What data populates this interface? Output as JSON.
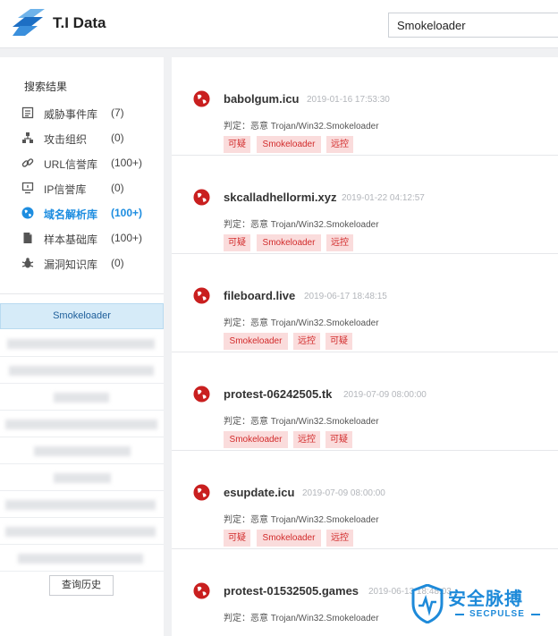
{
  "app": {
    "name": "T.I Data"
  },
  "search": {
    "value": "Smokeloader"
  },
  "sidebar": {
    "title": "搜索结果",
    "categories": [
      {
        "icon": "threat-event-icon",
        "label": "威胁事件库",
        "count": "(7)"
      },
      {
        "icon": "org-tree-icon",
        "label": "攻击组织",
        "count": "(0)"
      },
      {
        "icon": "link-icon",
        "label": "URL信誉库",
        "count": "(100+)"
      },
      {
        "icon": "ip-monitor-icon",
        "label": "IP信誉库",
        "count": "(0)"
      },
      {
        "icon": "globe-icon",
        "label": "域名解析库",
        "count": "(100+)"
      },
      {
        "icon": "document-icon",
        "label": "样本基础库",
        "count": "(100+)"
      },
      {
        "icon": "bug-icon",
        "label": "漏洞知识库",
        "count": "(0)"
      }
    ],
    "active_history": "Smokeloader",
    "history_button": "查询历史"
  },
  "results": [
    {
      "domain": "babolgum.icu",
      "date": "2019-01-16 17:53:30",
      "verdict": "判定：恶意 Trojan/Win32.Smokeloader",
      "tags": [
        "可疑",
        "Smokeloader",
        "远控"
      ]
    },
    {
      "domain": "skcalladhellormi.xyz",
      "date": "2019-01-22 04:12:57",
      "verdict": "判定：恶意 Trojan/Win32.Smokeloader",
      "tags": [
        "可疑",
        "Smokeloader",
        "远控"
      ]
    },
    {
      "domain": "fileboard.live",
      "date": "2019-06-17 18:48:15",
      "verdict": "判定：恶意 Trojan/Win32.Smokeloader",
      "tags": [
        "Smokeloader",
        "远控",
        "可疑"
      ]
    },
    {
      "domain": "protest-06242505.tk",
      "date": "2019-07-09 08:00:00",
      "verdict": "判定：恶意 Trojan/Win32.Smokeloader",
      "tags": [
        "Smokeloader",
        "远控",
        "可疑"
      ]
    },
    {
      "domain": "esupdate.icu",
      "date": "2019-07-09 08:00:00",
      "verdict": "判定：恶意 Trojan/Win32.Smokeloader",
      "tags": [
        "可疑",
        "Smokeloader",
        "远控"
      ]
    },
    {
      "domain": "protest-01532505.games",
      "date": "2019-06-13 18:48:03",
      "verdict": "判定：恶意 Trojan/Win32.Smokeloader",
      "tags": []
    }
  ],
  "watermark": {
    "text": "安全脉搏",
    "subtext": "SECPULSE"
  },
  "colors": {
    "accent": "#1d8de0",
    "tag_bg": "#fadcdc",
    "tag_text": "#d22b2b",
    "active_history_bg": "#d6ebf8"
  }
}
